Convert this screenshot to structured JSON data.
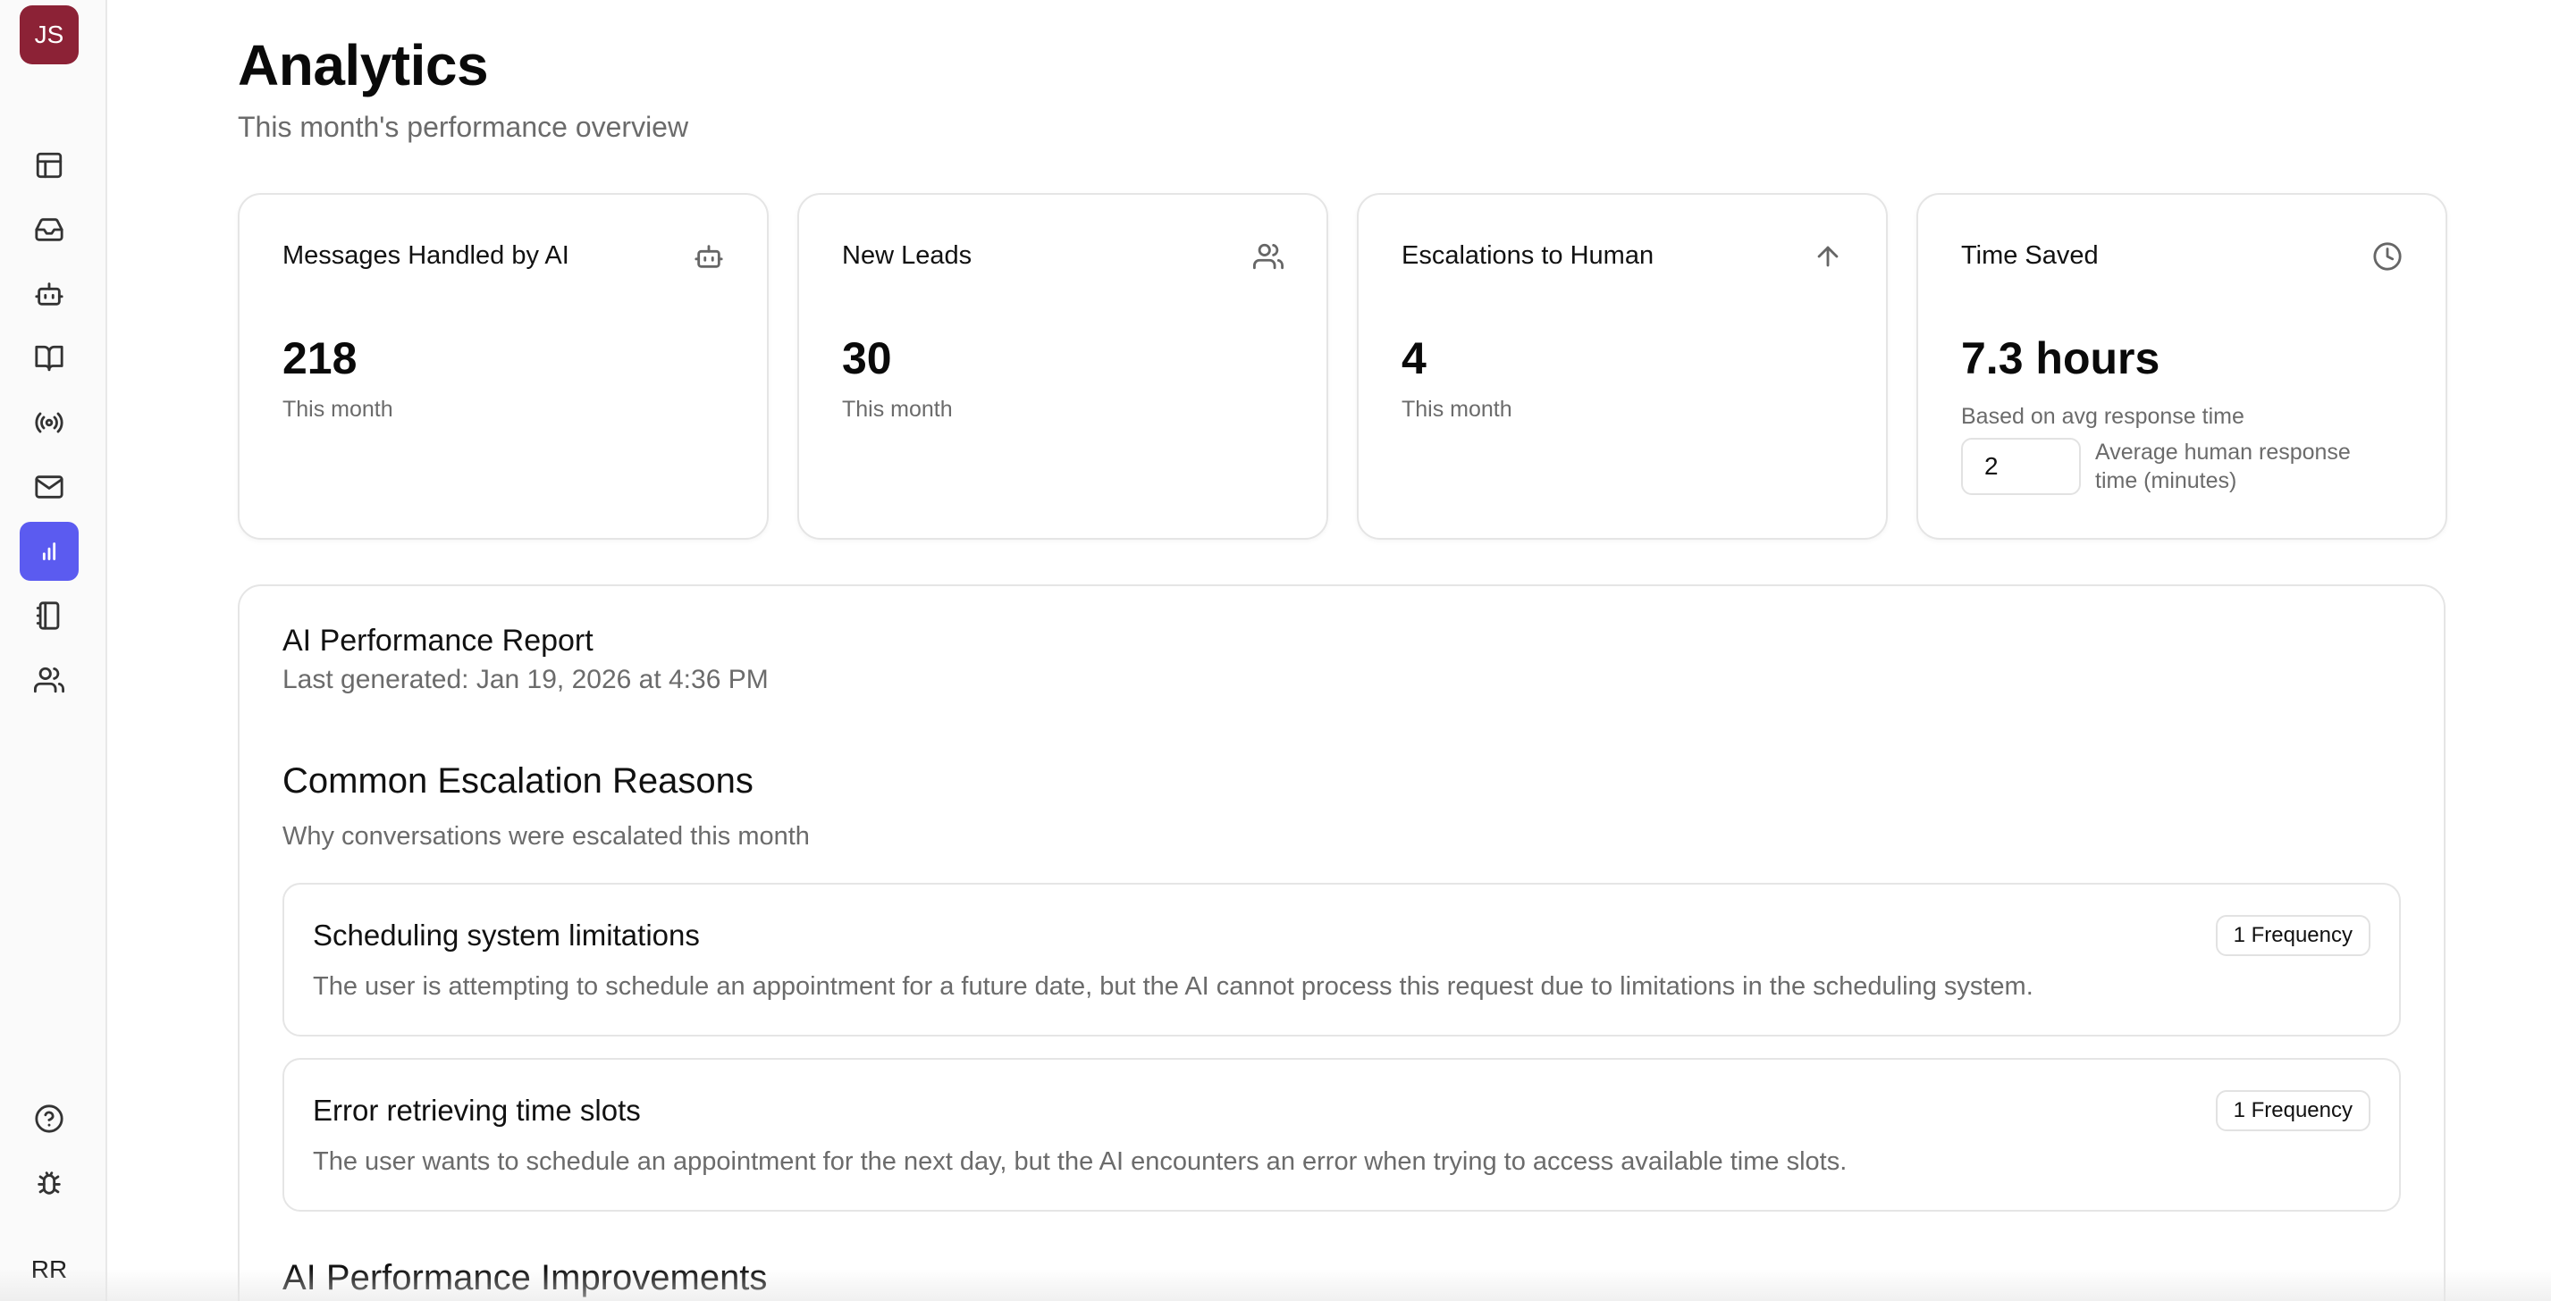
{
  "sidebar": {
    "user_initials": "JS",
    "account_initials": "RR",
    "active_color": "#5b5bf0",
    "avatar_color": "#8c2236",
    "nav": [
      {
        "icon": "layout-icon"
      },
      {
        "icon": "inbox-icon"
      },
      {
        "icon": "bot-icon"
      },
      {
        "icon": "book-open-icon"
      },
      {
        "icon": "broadcast-icon"
      },
      {
        "icon": "mail-icon"
      },
      {
        "icon": "analytics-icon",
        "active": true
      },
      {
        "icon": "notebook-icon"
      },
      {
        "icon": "users-icon"
      }
    ],
    "bottom": [
      {
        "icon": "help-circle-icon"
      },
      {
        "icon": "bug-icon"
      }
    ]
  },
  "header": {
    "title": "Analytics",
    "subtitle": "This month's performance overview"
  },
  "stats": [
    {
      "label": "Messages Handled by AI",
      "value": "218",
      "caption": "This month",
      "icon": "bot-icon"
    },
    {
      "label": "New Leads",
      "value": "30",
      "caption": "This month",
      "icon": "users-icon"
    },
    {
      "label": "Escalations to Human",
      "value": "4",
      "caption": "This month",
      "icon": "arrow-up-icon"
    },
    {
      "label": "Time Saved",
      "value": "7.3 hours",
      "caption": "Based on avg response time",
      "icon": "clock-icon",
      "input_value": "2",
      "input_label": "Average human response time (minutes)"
    }
  ],
  "report": {
    "title": "AI Performance Report",
    "generated": "Last generated: Jan 19, 2026 at 4:36 PM",
    "escalations_title": "Common Escalation Reasons",
    "escalations_subtitle": "Why conversations were escalated this month",
    "reasons": [
      {
        "title": "Scheduling system limitations",
        "description": "The user is attempting to schedule an appointment for a future date, but the AI cannot process this request due to limitations in the scheduling system.",
        "badge": "1 Frequency"
      },
      {
        "title": "Error retrieving time slots",
        "description": "The user wants to schedule an appointment for the next day, but the AI encounters an error when trying to access available time slots.",
        "badge": "1 Frequency"
      }
    ],
    "improvements_title": "AI Performance Improvements"
  }
}
